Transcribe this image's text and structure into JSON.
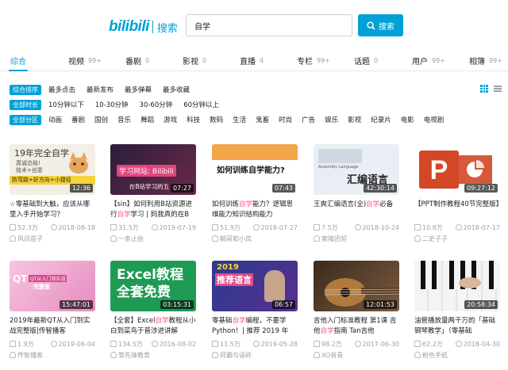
{
  "header": {
    "logo_brand": "bilibili",
    "logo_sub": "搜索",
    "search_value": "自学",
    "search_button": "搜索"
  },
  "tabs": [
    {
      "label": "综合",
      "count": ""
    },
    {
      "label": "视频",
      "count": "99+"
    },
    {
      "label": "番剧",
      "count": "0"
    },
    {
      "label": "影视",
      "count": "0"
    },
    {
      "label": "直播",
      "count": "4"
    },
    {
      "label": "专栏",
      "count": "99+"
    },
    {
      "label": "话题",
      "count": "0"
    },
    {
      "label": "用户",
      "count": "99+"
    },
    {
      "label": "相簿",
      "count": "99+"
    }
  ],
  "filters": {
    "sort": {
      "tag": "综合排序",
      "options": [
        "最多点击",
        "最新发布",
        "最多弹幕",
        "最多收藏"
      ]
    },
    "duration": {
      "tag": "全部时长",
      "options": [
        "10分钟以下",
        "10-30分钟",
        "30-60分钟",
        "60分钟以上"
      ]
    },
    "zone": {
      "tag": "全部分区",
      "options": [
        "动画",
        "番剧",
        "国创",
        "音乐",
        "舞蹈",
        "游戏",
        "科技",
        "数码",
        "生活",
        "鬼畜",
        "时尚",
        "广告",
        "娱乐",
        "影视",
        "纪录片",
        "电影",
        "电视剧"
      ]
    }
  },
  "thumbs": {
    "t1": {
      "line1": "19年完全自学",
      "line2": "真诚总结!",
      "line3": "技术+创意",
      "line4": "防弯路+好方向+小捷径"
    },
    "t2": {
      "line1": "学习网站: Bilibili",
      "line2": "在B站学习的五"
    },
    "t3": {
      "line1": "如何训练自学能力?"
    },
    "t4": {
      "line1": "汇编语言",
      "line2": "Assembly Language"
    },
    "t6": {
      "line1": "QT从入门到实战",
      "line2": "完整版"
    },
    "t7": {
      "line1": "Excel教程",
      "line2": "全套免费"
    },
    "t8": {
      "line1": "2019",
      "line2": "推荐语言"
    }
  },
  "videos": [
    {
      "duration": "12:36",
      "title_pre": "☆零基础到大触，应该从哪里入手开始学习？",
      "title_hl": "",
      "title_post": "",
      "views": "52.3万",
      "date": "2018-08-18",
      "author": "风间苗子"
    },
    {
      "duration": "07:27",
      "title_pre": "【sin】如何利用B站资源进行",
      "title_hl": "自学",
      "title_post": "学习 | 妈我真的在B",
      "views": "31.5万",
      "date": "2019-07-19",
      "author": "一条止佐"
    },
    {
      "duration": "07:43",
      "title_pre": "如何训练",
      "title_hl": "自学",
      "title_post": "能力？逻辑思维能力知识结构能力",
      "views": "51.9万",
      "date": "2018-07-27",
      "author": "鲷哥和小岚"
    },
    {
      "duration": "42:30:14",
      "title_pre": "王爽汇编语言(全)",
      "title_hl": "自学",
      "title_post": "必备",
      "views": "7.5万",
      "date": "2018-10-24",
      "author": "索隆团契"
    },
    {
      "duration": "09:27:12",
      "title_pre": "【PPT制作教程40节完整版】",
      "title_hl": "",
      "title_post": "",
      "views": "10.8万",
      "date": "2018-07-17",
      "author": "二史子子"
    },
    {
      "duration": "15:47:01",
      "title_pre": "2019年最新QT从入门到实战完整版|传智播客",
      "title_hl": "",
      "title_post": "",
      "views": "1.9万",
      "date": "2019-06-04",
      "author": "传智播客"
    },
    {
      "duration": "03:15:31",
      "title_pre": "【全套】Excel",
      "title_hl": "自学",
      "title_post": "教程从小白到菜鸟于普涉进讲解",
      "views": "134.5万",
      "date": "2016-08-02",
      "author": "黎先锋教育"
    },
    {
      "duration": "06:57",
      "title_pre": "零基础",
      "title_hl": "自学",
      "title_post": "编程，不要学Python！| 推荐 2019 年",
      "views": "11.5万",
      "date": "2019-05-28",
      "author": "阿霸与语碎"
    },
    {
      "duration": "12:01:53",
      "title_pre": "吉他入门标准教程 第1课 吉他",
      "title_hl": "自学",
      "title_post": "指南 Tan吉他",
      "views": "98.2万",
      "date": "2017-06-30",
      "author": "XO音青"
    },
    {
      "duration": "20:58:34",
      "title_pre": "油管播放量两千万的「基础钢琴教学」（零基础",
      "title_hl": "",
      "title_post": "",
      "views": "62.2万",
      "date": "2018-04-30",
      "author": "粉色手纸"
    }
  ],
  "colors": {
    "accent": "#00a1d6",
    "highlight": "#f25d8e",
    "muted": "#99a2aa"
  }
}
